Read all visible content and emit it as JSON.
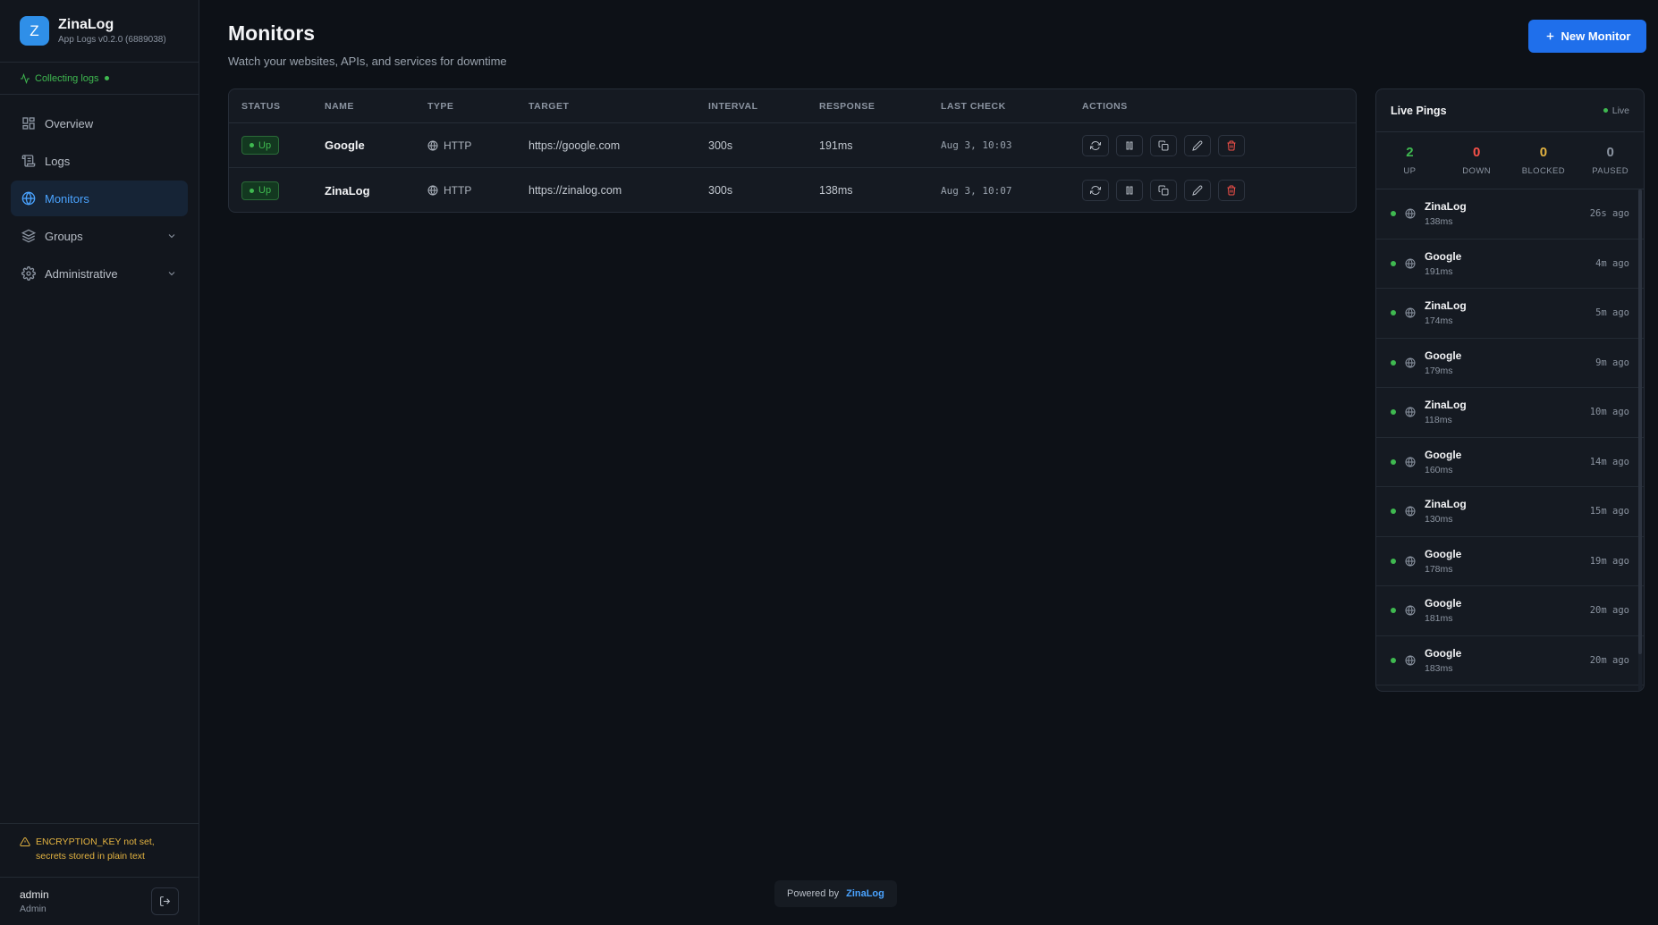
{
  "app": {
    "logo_letter": "Z",
    "name": "ZinaLog",
    "version": "App Logs v0.2.0 (6889038)",
    "collecting": "Collecting logs"
  },
  "sidebar": {
    "items": [
      {
        "label": "Overview",
        "icon": "grid-icon"
      },
      {
        "label": "Logs",
        "icon": "scroll-icon"
      },
      {
        "label": "Monitors",
        "icon": "globe-icon",
        "active": true
      },
      {
        "label": "Groups",
        "icon": "layers-icon",
        "expandable": true
      },
      {
        "label": "Administrative",
        "icon": "gear-icon",
        "expandable": true
      }
    ],
    "warning": "ENCRYPTION_KEY not set, secrets stored in plain text",
    "user": {
      "name": "admin",
      "role": "Admin"
    }
  },
  "header": {
    "title": "Monitors",
    "subtitle": "Watch your websites, APIs, and services for downtime",
    "new_button": "New Monitor"
  },
  "table": {
    "columns": [
      "STATUS",
      "NAME",
      "TYPE",
      "TARGET",
      "INTERVAL",
      "RESPONSE",
      "LAST CHECK",
      "ACTIONS"
    ],
    "rows": [
      {
        "status": "Up",
        "name": "Google",
        "type": "HTTP",
        "target": "https://google.com",
        "interval": "300s",
        "response": "191ms",
        "last_check": "Aug 3, 10:03"
      },
      {
        "status": "Up",
        "name": "ZinaLog",
        "type": "HTTP",
        "target": "https://zinalog.com",
        "interval": "300s",
        "response": "138ms",
        "last_check": "Aug 3, 10:07"
      }
    ]
  },
  "pings": {
    "title": "Live Pings",
    "live_label": "Live",
    "stats": [
      {
        "value": "2",
        "label": "UP",
        "color": "#3fb950"
      },
      {
        "value": "0",
        "label": "DOWN",
        "color": "#f85149"
      },
      {
        "value": "0",
        "label": "BLOCKED",
        "color": "#e3b341"
      },
      {
        "value": "0",
        "label": "PAUSED",
        "color": "#8b94a1"
      }
    ],
    "items": [
      {
        "name": "ZinaLog",
        "ms": "138ms",
        "ago": "26s ago"
      },
      {
        "name": "Google",
        "ms": "191ms",
        "ago": "4m ago"
      },
      {
        "name": "ZinaLog",
        "ms": "174ms",
        "ago": "5m ago"
      },
      {
        "name": "Google",
        "ms": "179ms",
        "ago": "9m ago"
      },
      {
        "name": "ZinaLog",
        "ms": "118ms",
        "ago": "10m ago"
      },
      {
        "name": "Google",
        "ms": "160ms",
        "ago": "14m ago"
      },
      {
        "name": "ZinaLog",
        "ms": "130ms",
        "ago": "15m ago"
      },
      {
        "name": "Google",
        "ms": "178ms",
        "ago": "19m ago"
      },
      {
        "name": "Google",
        "ms": "181ms",
        "ago": "20m ago"
      },
      {
        "name": "Google",
        "ms": "183ms",
        "ago": "20m ago"
      }
    ]
  },
  "footer": {
    "powered_by": "Powered by",
    "brand": "ZinaLog"
  }
}
